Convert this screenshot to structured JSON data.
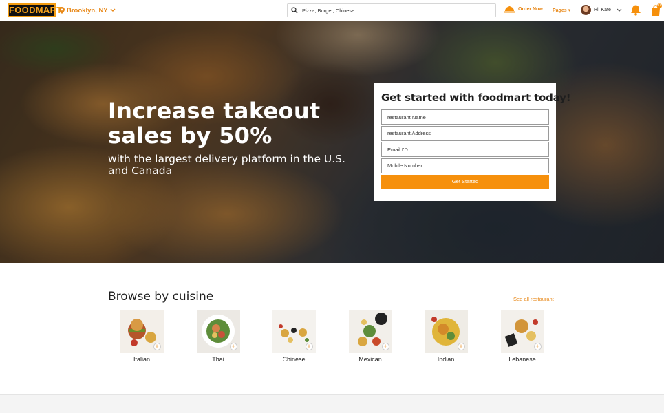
{
  "header": {
    "logo": "FOODMART",
    "location": "Brooklyn, NY",
    "search_placeholder": "Pizza, Burger, Chinese",
    "order_now": "Order Now",
    "pages": "Pages",
    "user_greeting": "Hi, Kate",
    "cart_count": "0"
  },
  "hero": {
    "title": "Increase takeout sales by 50%",
    "subtitle": "with the largest delivery platform in the U.S. and Canada"
  },
  "signup": {
    "title": "Get started with foodmart today!",
    "fields": {
      "name": "restaurant Name",
      "address": "restaurant Address",
      "email": "Email I'D",
      "mobile": "Mobile Number"
    },
    "button": "Get Started"
  },
  "browse": {
    "title": "Browse by cuisine",
    "see_all": "See all restaurant",
    "cuisines": [
      {
        "name": "Italian",
        "color": "#b5552b"
      },
      {
        "name": "Thai",
        "color": "#5e8d3a"
      },
      {
        "name": "Chinese",
        "color": "#d9a640"
      },
      {
        "name": "Mexican",
        "color": "#c94a2a"
      },
      {
        "name": "Indian",
        "color": "#e0b53a"
      },
      {
        "name": "Lebanese",
        "color": "#d2953a"
      }
    ]
  },
  "colors": {
    "accent": "#f6900c",
    "accent_text": "#e8891a"
  }
}
